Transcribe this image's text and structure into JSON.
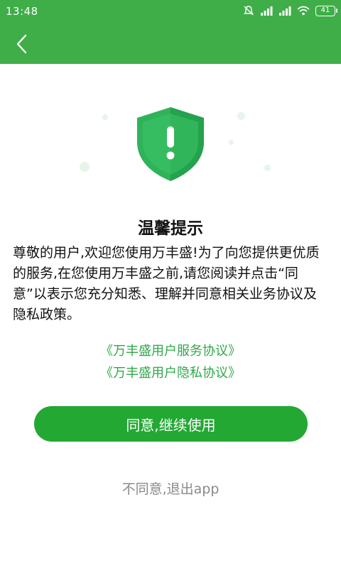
{
  "status_bar": {
    "time": "13:48",
    "battery": "41"
  },
  "header": {
    "back_icon": "chevron-left-icon"
  },
  "dialog": {
    "title": "温馨提示",
    "message": "尊敬的用户,欢迎您使用万丰盛!为了向您提供更优质的服务,在您使用万丰盛之前,请您阅读并点击“同意”以表示您充分知悉、理解并同意相关业务协议及隐私政策。",
    "service_link": "《万丰盛用户服务协议》",
    "privacy_link": "《万丰盛用户隐私协议》",
    "agree_button": "同意,继续使用",
    "disagree_link": "不同意,退出app"
  },
  "colors": {
    "accent": "#3fae48",
    "button": "#23a834",
    "link": "#2fa84a",
    "secondary_text": "#8a8a8a"
  }
}
